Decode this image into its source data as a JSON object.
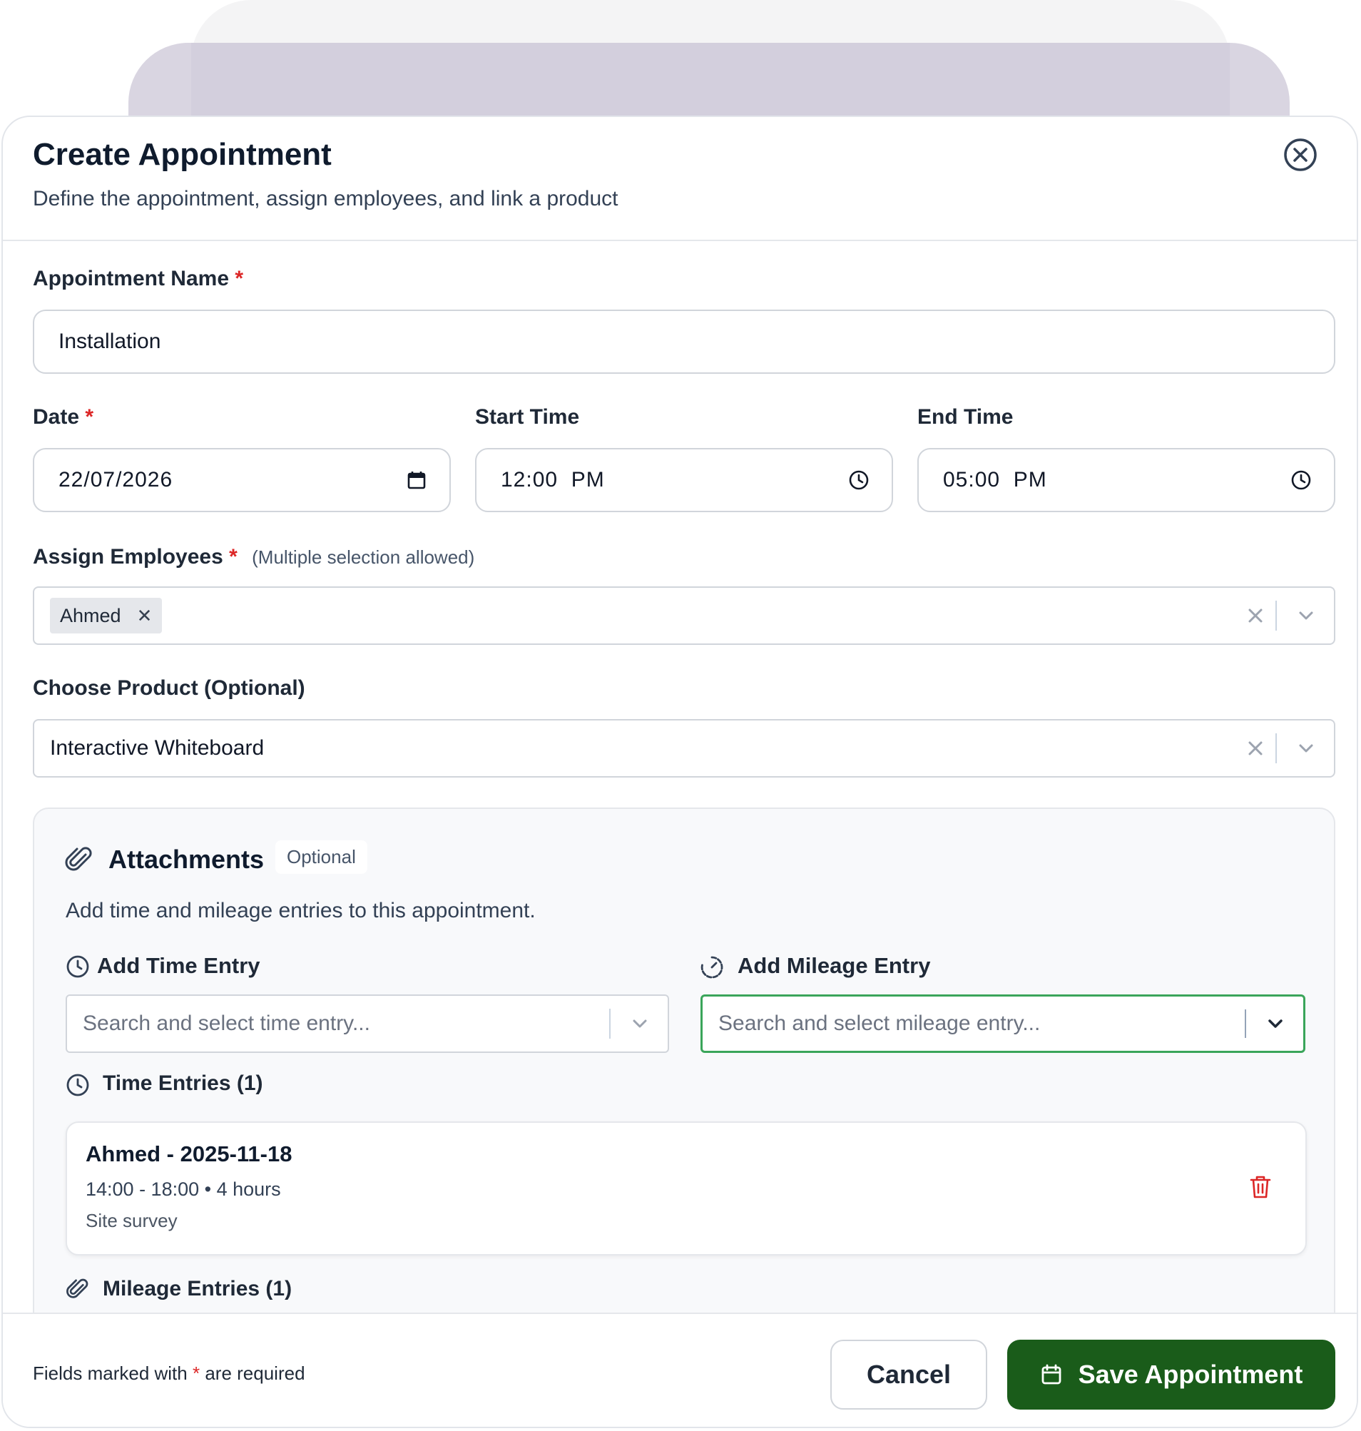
{
  "dialog": {
    "title": "Create Appointment",
    "subtitle": "Define the appointment, assign employees, and link a product"
  },
  "form": {
    "name_label": "Appointment Name",
    "name_value": "Installation",
    "date_label": "Date",
    "date_value": "22/07/2026",
    "start_label": "Start Time",
    "start_value": "12:00  PM",
    "end_label": "End Time",
    "end_value": "05:00  PM",
    "employees_label": "Assign Employees",
    "employees_hint": "(Multiple selection allowed)",
    "employees_selected": [
      "Ahmed"
    ],
    "product_label": "Choose Product (Optional)",
    "product_value": "Interactive Whiteboard",
    "required_mark": "*"
  },
  "attachments": {
    "title": "Attachments",
    "badge": "Optional",
    "description": "Add time and mileage entries to this appointment.",
    "time_entry_label": "Add Time Entry",
    "time_entry_placeholder": "Search and select time entry...",
    "mileage_entry_label": "Add Mileage Entry",
    "mileage_entry_placeholder": "Search and select mileage entry...",
    "time_entries_heading": "Time Entries (1)",
    "time_entries": [
      {
        "title": "Ahmed - 2025-11-18",
        "detail": "14:00 - 18:00 • 4 hours",
        "note": "Site survey"
      }
    ],
    "mileage_entries_heading": "Mileage Entries (1)"
  },
  "footer": {
    "note_prefix": "Fields marked with",
    "note_mark": "*",
    "note_suffix": "are required",
    "cancel_label": "Cancel",
    "save_label": "Save Appointment"
  },
  "colors": {
    "accent": "#1a5c1a",
    "required": "#dc2626",
    "focus_border": "#3aa55a",
    "delete": "#dc2626"
  }
}
